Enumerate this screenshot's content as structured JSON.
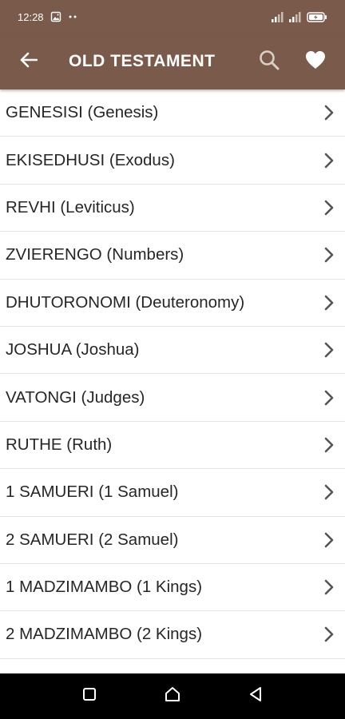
{
  "status_bar": {
    "time": "12:28",
    "icons": [
      "image-icon",
      "more-dots-icon",
      "signal-icon",
      "signal-icon-2",
      "battery-charging-icon"
    ]
  },
  "app_bar": {
    "title": "OLD TESTAMENT",
    "back_icon": "arrow-left-icon",
    "search_icon": "search-icon",
    "favorite_icon": "heart-icon",
    "background": "#7a5a4a"
  },
  "books": [
    {
      "label": "GENESISI (Genesis)"
    },
    {
      "label": "EKISEDHUSI (Exodus)"
    },
    {
      "label": "REVHI (Leviticus)"
    },
    {
      "label": "ZVIERENGO (Numbers)"
    },
    {
      "label": "DHUTORONOMI (Deuteronomy)"
    },
    {
      "label": "JOSHUA (Joshua)"
    },
    {
      "label": "VATONGI (Judges)"
    },
    {
      "label": "RUTHE (Ruth)"
    },
    {
      "label": "1 SAMUERI (1 Samuel)"
    },
    {
      "label": "2 SAMUERI (2 Samuel)"
    },
    {
      "label": "1 MADZIMAMBO (1 Kings)"
    },
    {
      "label": "2 MADZIMAMBO (2 Kings)"
    }
  ],
  "nav_bar": {
    "icons": [
      "recents-square-icon",
      "home-icon",
      "back-triangle-icon"
    ]
  }
}
